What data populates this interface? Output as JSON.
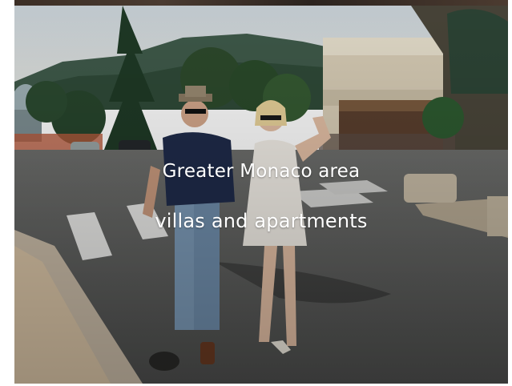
{
  "hero": {
    "headline_line1": "Greater Monaco area",
    "headline_line2": "villas and apartments",
    "text_color": "#ffffff"
  }
}
